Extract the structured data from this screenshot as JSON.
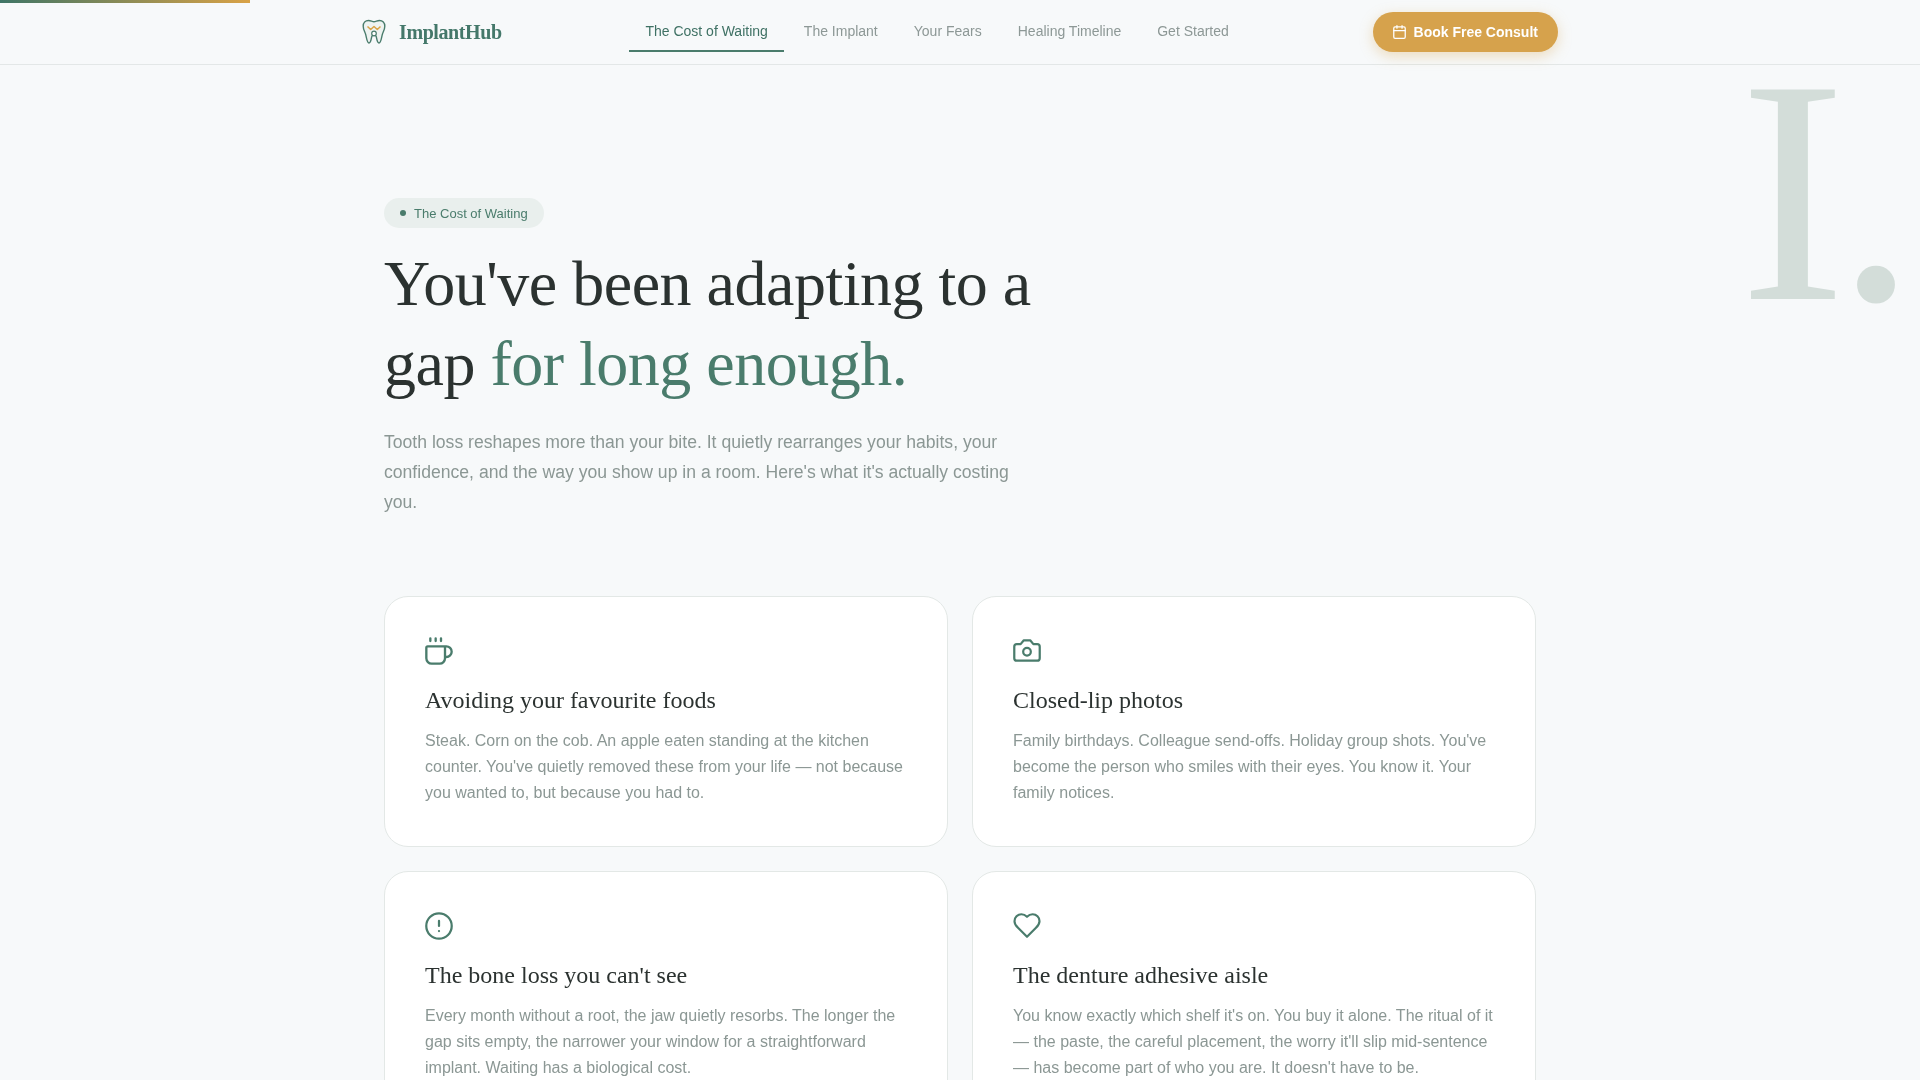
{
  "reading_progress": {
    "level": 0.13
  },
  "header": {
    "logo_text": "ImplantHub",
    "nav": [
      {
        "label": "The Cost of Waiting",
        "selected": true
      },
      {
        "label": "The Implant",
        "selected": false
      },
      {
        "label": "Your Fears",
        "selected": false
      },
      {
        "label": "Healing Timeline",
        "selected": false
      },
      {
        "label": "Get Started",
        "selected": false
      }
    ],
    "cta": "Book Free Consult"
  },
  "hero": {
    "section_numeral": "I.",
    "badge": "The Cost of Waiting",
    "title": "You've been adapting to a gap",
    "title_accent": "for long enough.",
    "intro": "Tooth loss reshapes more than your bite. It quietly rearranges your habits, your confidence, and the way you show up in a room. Here's what it's actually costing you."
  },
  "cards": [
    {
      "title": "Avoiding your favourite foods",
      "text": "Steak. Corn on the cob. An apple eaten standing at the kitchen counter. You've quietly removed these from your life — not because you wanted to, but because you had to."
    },
    {
      "title": "Closed-lip photos",
      "text": "Family birthdays. Colleague send-offs. Holiday group shots. You've become the person who smiles with their eyes. You know it. Your family notices."
    },
    {
      "title": "The bone loss you can't see",
      "text": "Every month without a root, the jaw quietly resorbs. The longer the gap sits empty, the narrower your window for a straightforward implant. Waiting has a biological cost."
    },
    {
      "title": "The denture adhesive aisle",
      "text": "You know exactly which shelf it's on. You buy it alone. The ritual of it — the paste, the careful placement, the worry it'll slip mid-sentence — has become part of who you are. It doesn't have to be."
    }
  ]
}
